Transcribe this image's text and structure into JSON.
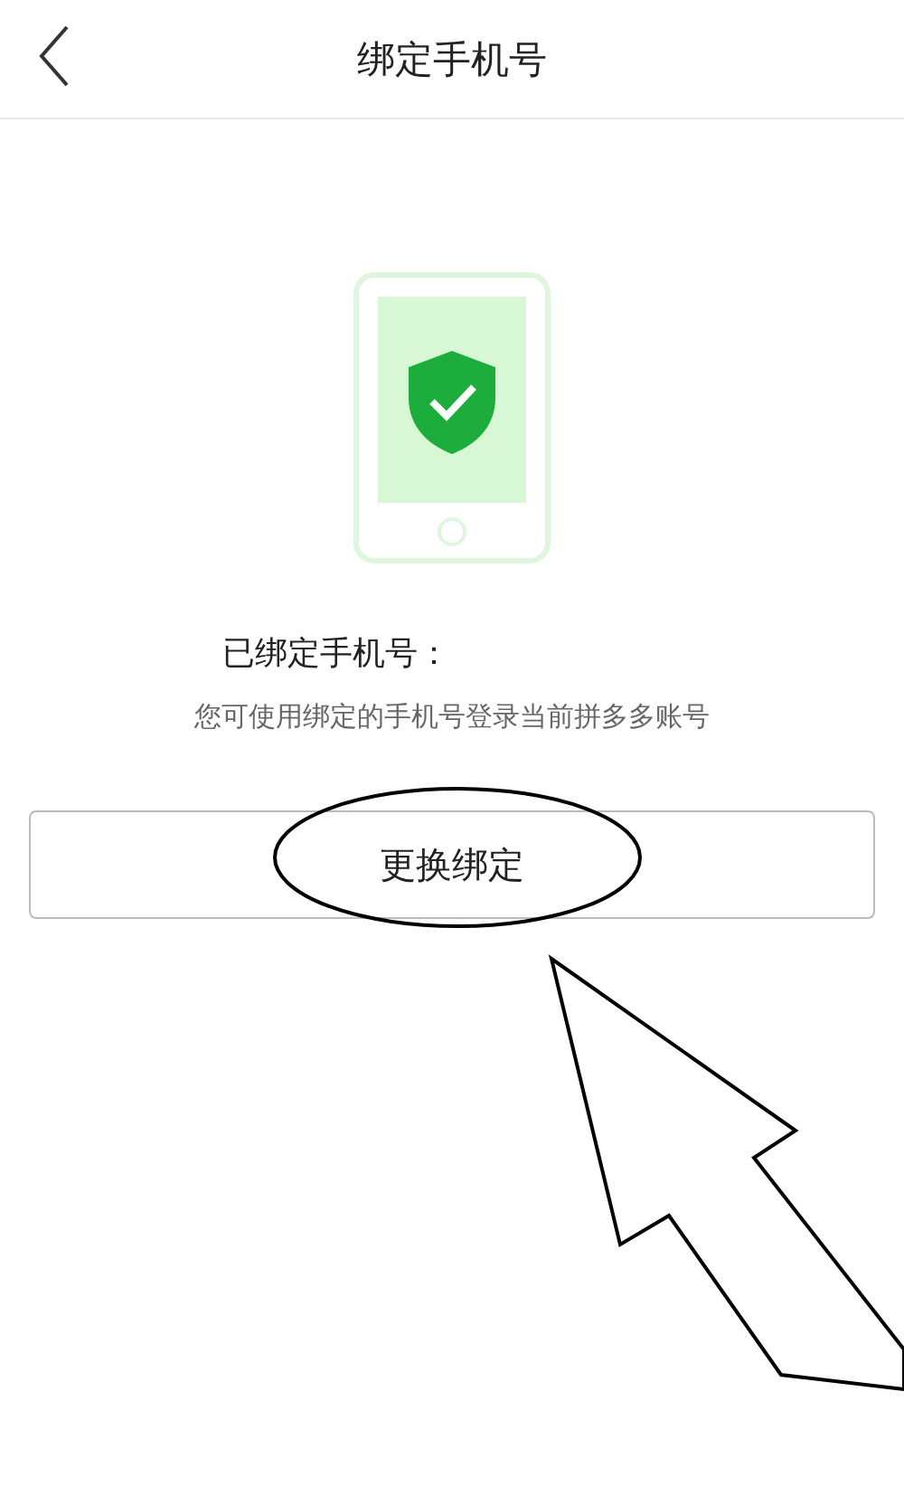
{
  "header": {
    "title": "绑定手机号"
  },
  "status": {
    "title": "已绑定手机号：",
    "description": "您可使用绑定的手机号登录当前拼多多账号"
  },
  "buttons": [
    {
      "label": "更换绑定"
    }
  ]
}
